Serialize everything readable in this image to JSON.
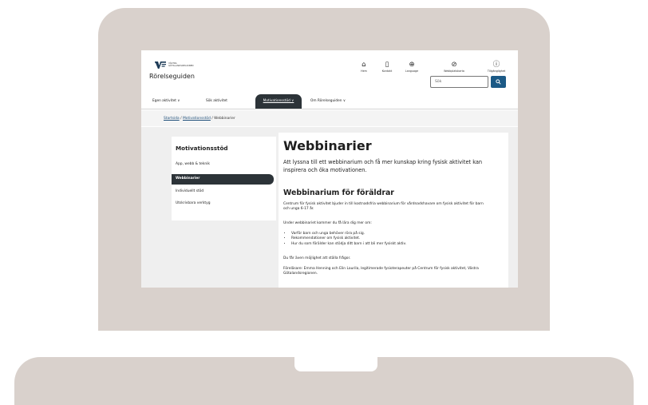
{
  "header": {
    "logo_text_line1": "VÄSTRA",
    "logo_text_line2": "GÖTALANDSREGIONEN",
    "site_title": "Rörelseguiden",
    "utility": [
      {
        "icon": "home-icon",
        "glyph": "⌂",
        "label": "Hem"
      },
      {
        "icon": "phone-icon",
        "glyph": "▯",
        "label": "Kontakt"
      },
      {
        "icon": "globe-icon",
        "glyph": "⊕",
        "label": "Language"
      },
      {
        "icon": "sitemap-icon",
        "glyph": "⊘",
        "label": "Webbplatskarta"
      },
      {
        "icon": "accessibility-icon",
        "glyph": "ⓘ",
        "label": "Tillgänglighet"
      }
    ],
    "search_placeholder": "Sök",
    "search_button_icon": "search-icon"
  },
  "nav": {
    "items": [
      "Egen aktivitet ∨",
      "Sök aktivitet",
      "Motivationsstöd ∨",
      "Om Rörelseguiden ∨"
    ],
    "active_index": 2
  },
  "breadcrumb": {
    "home": "Startsida",
    "parent": "Motivationsstöd",
    "current": "Webbinarier",
    "separator": " / "
  },
  "sidebar": {
    "title": "Motivationsstöd",
    "items": [
      "App, webb & teknik",
      "Webbinarier",
      "Individuellt stöd",
      "Utskrivbara verktyg"
    ],
    "active_index": 1
  },
  "main": {
    "title": "Webbinarier",
    "intro": "Att lyssna till ett webbinarium och få mer kunskap kring fysisk aktivitet kan inspirera och öka motivationen.",
    "section_title": "Webbinarium för föräldrar",
    "section_p1": "Centrum för fysisk aktivitet bjuder in till kostnadsfria webbinarium för vårdnadshavare om fysisk aktivitet för barn och unga 6-17 år.",
    "section_p2": "Under webbinariet kommer du få lära dig mer om:",
    "bullets": [
      "Varför barn och unga behöver röra på sig.",
      "Rekommendationer om fysisk aktivitet.",
      "Hur du som förälder kan stödja ditt barn i att bli mer fysiskt aktiv."
    ],
    "section_p3": "Du får även möjlighet att ställa frågor.",
    "section_p4": "Föreläsare: Emma Henning och Elin Laurila, legitimerade fysioterapeuter på Centrum för fysisk aktivitet, Västra Götalandsregionen."
  },
  "colors": {
    "frame": "#d9d1cc",
    "dark_accent": "#2c3338",
    "search_button": "#1c5a86",
    "content_background": "#efefef"
  }
}
